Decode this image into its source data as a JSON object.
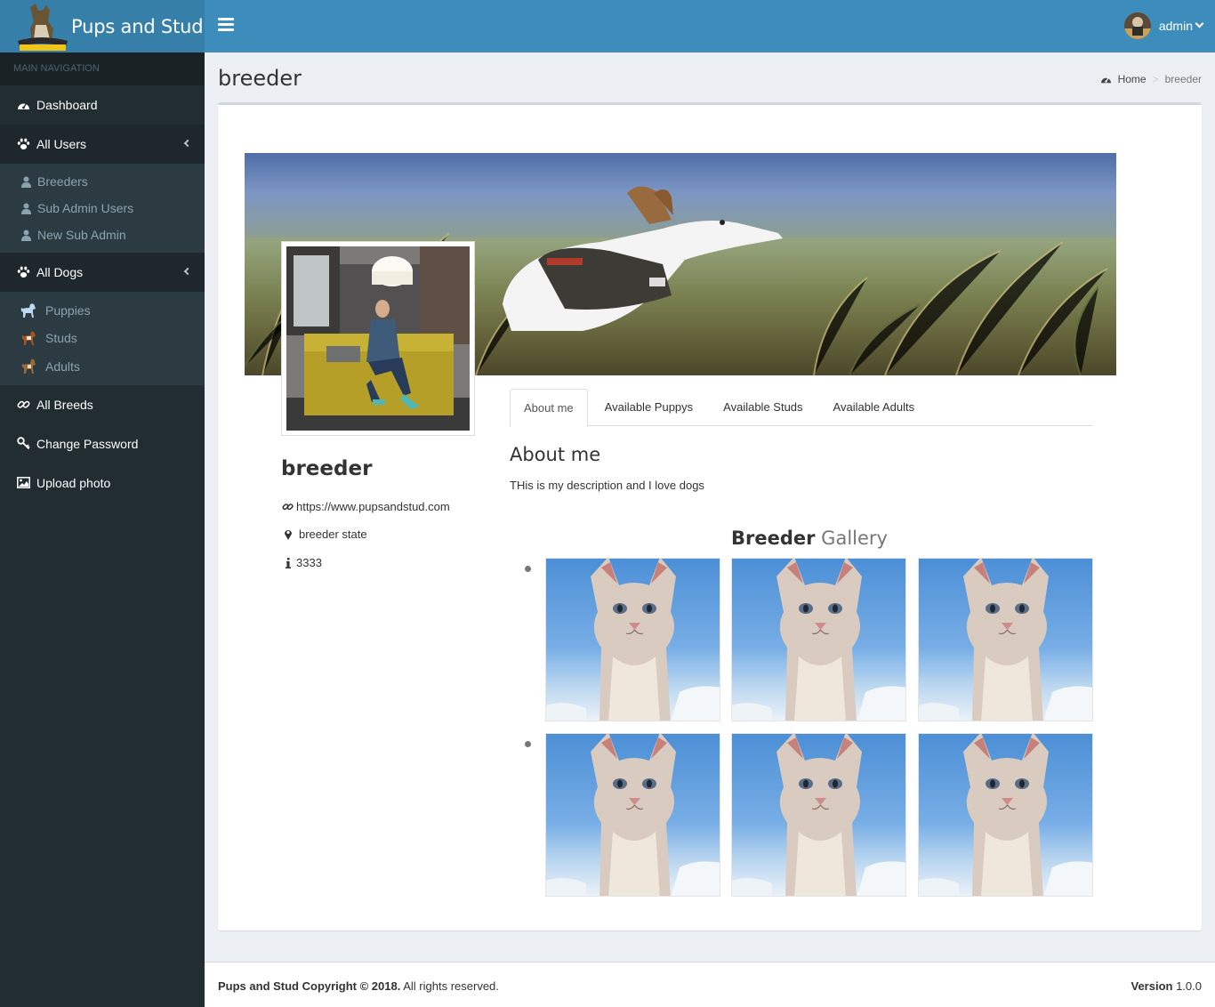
{
  "brand": {
    "name": "Pups and Stud"
  },
  "user": {
    "name": "admin"
  },
  "sidebar": {
    "header": "MAIN NAVIGATION",
    "items": [
      {
        "label": "Dashboard",
        "icon": "dashboard-icon"
      },
      {
        "label": "All Users",
        "icon": "paw-icon"
      },
      {
        "label": "All Dogs",
        "icon": "paw-icon"
      },
      {
        "label": "All Breeds",
        "icon": "link-icon"
      },
      {
        "label": "Change Password",
        "icon": "key-icon"
      },
      {
        "label": "Upload photo",
        "icon": "image-icon"
      }
    ],
    "users_sub": [
      {
        "label": "Breeders",
        "icon": "user-icon"
      },
      {
        "label": "Sub Admin Users",
        "icon": "user-icon"
      },
      {
        "label": "New Sub Admin",
        "icon": "user-icon"
      }
    ],
    "dogs_sub": [
      {
        "label": "Puppies",
        "icon": "puppy-icon"
      },
      {
        "label": "Studs",
        "icon": "stud-dog-icon"
      },
      {
        "label": "Adults",
        "icon": "adult-dog-icon"
      }
    ]
  },
  "page": {
    "title": "breeder"
  },
  "breadcrumb": {
    "home": "Home",
    "current": "breeder"
  },
  "profile": {
    "name": "breeder",
    "website": "https://www.pupsandstud.com",
    "state": "breeder state",
    "info": "3333"
  },
  "tabs": [
    "About me",
    "Available Puppys",
    "Available Studs",
    "Available Adults"
  ],
  "about": {
    "title": "About me",
    "text": "THis is my description and I love dogs"
  },
  "gallery": {
    "title_bold": "Breeder",
    "title_rest": "Gallery"
  },
  "footer": {
    "copyright_bold": "Pups and Stud Copyright © 2018.",
    "copyright_rest": "All rights reserved.",
    "version_label": "Version",
    "version": "1.0.0"
  },
  "colors": {
    "header": "#3c8dbc",
    "logo_bg": "#367fa9",
    "sidebar": "#222d32"
  }
}
